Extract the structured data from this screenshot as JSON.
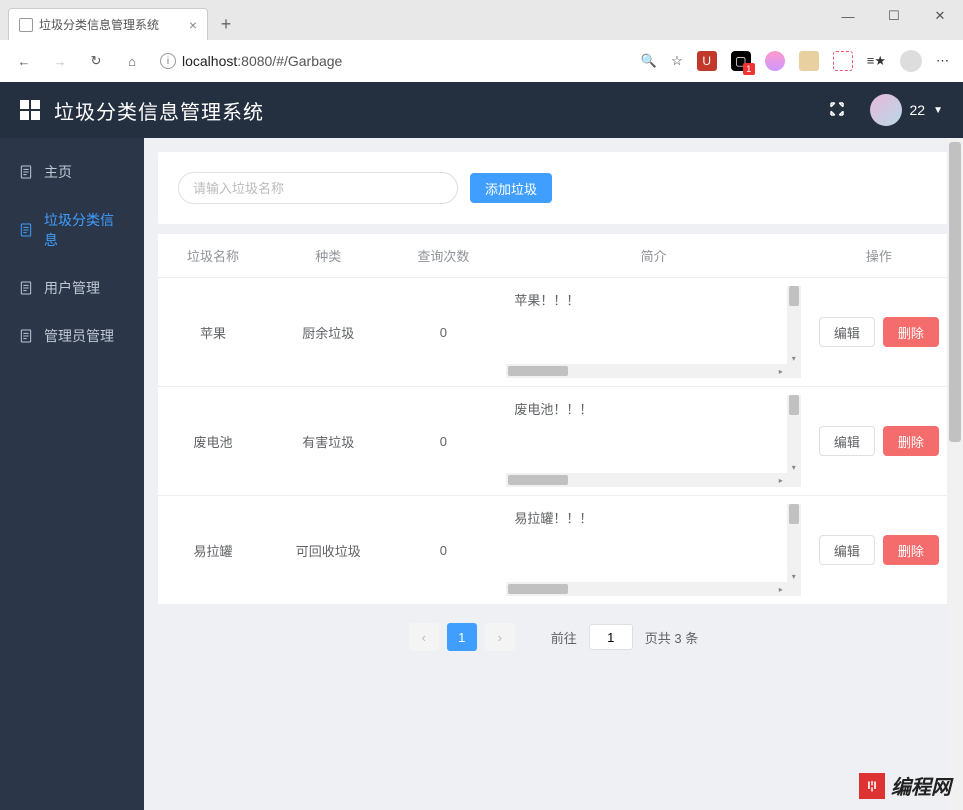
{
  "browser": {
    "tab_title": "垃圾分类信息管理系统",
    "url_host": "localhost",
    "url_path": ":8080/#/Garbage"
  },
  "header": {
    "title": "垃圾分类信息管理系统",
    "user_name": "22"
  },
  "sidebar": {
    "items": [
      {
        "label": "主页"
      },
      {
        "label": "垃圾分类信息"
      },
      {
        "label": "用户管理"
      },
      {
        "label": "管理员管理"
      }
    ],
    "active_index": 1
  },
  "toolbar": {
    "search_placeholder": "请输入垃圾名称",
    "add_label": "添加垃圾"
  },
  "table": {
    "headers": [
      "垃圾名称",
      "种类",
      "查询次数",
      "简介",
      "操作"
    ],
    "edit_label": "编辑",
    "delete_label": "删除",
    "rows": [
      {
        "name": "苹果",
        "category": "厨余垃圾",
        "count": "0",
        "desc": "苹果！！！"
      },
      {
        "name": "废电池",
        "category": "有害垃圾",
        "count": "0",
        "desc": "废电池！！！"
      },
      {
        "name": "易拉罐",
        "category": "可回收垃圾",
        "count": "0",
        "desc": "易拉罐！！！"
      }
    ]
  },
  "pager": {
    "current": "1",
    "goto_prefix": "前往",
    "goto_input": "1",
    "total_text": "页共 3 条"
  },
  "watermark": "编程网"
}
